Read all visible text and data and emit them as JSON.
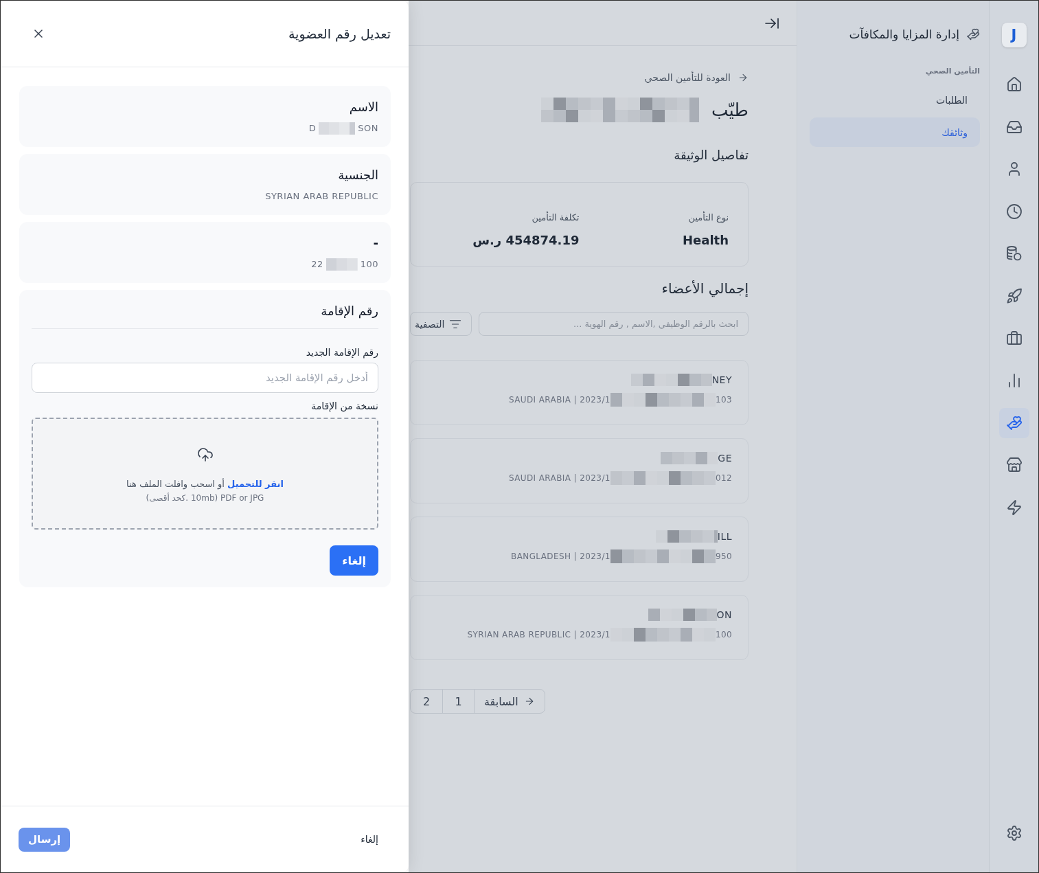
{
  "drawer": {
    "title": "تعديل رقم العضوية",
    "info_cards": [
      {
        "kind": "redacted",
        "label": "الاسم",
        "value_start": "D",
        "value_end": "SON"
      },
      {
        "kind": "plain",
        "label": "الجنسية",
        "value": "SYRIAN ARAB REPUBLIC"
      },
      {
        "kind": "redacted",
        "label": "-",
        "value_start": "22",
        "value_end": "100"
      }
    ],
    "residence": {
      "title": "رقم الإقامة",
      "field_label": "رقم الإقامة الجديد",
      "placeholder": "أدخل رقم الإقامة الجديد",
      "upload_label": "نسخة من الإقامة",
      "upload_link": "انقر للتحميل",
      "upload_text": "أو اسحب وافلت الملف هنا",
      "file_types": "PDF or JPG",
      "size_limit": "(10mb .كحد أقصى)",
      "button": "إلغاء"
    },
    "footer": {
      "cancel": "إلغاء",
      "submit": {
        "label": "إرسال",
        "disabled": true
      }
    }
  },
  "page": {
    "back_link": "العودة للتأمين الصحي",
    "title": "طيّب",
    "policy": {
      "heading": "تفاصيل الوثيقة",
      "fields": [
        {
          "label": "نوع التأمين",
          "value": "Health"
        },
        {
          "label": "تكلفة التأمين",
          "value": "454874.19 ر.س"
        }
      ]
    },
    "members": {
      "heading": "إجمالي الأعضاء",
      "search_placeholder": "ابحث بالرقم الوظيفي ,الاسم , رقم الهوية ...",
      "filter": "التصفية",
      "rows": [
        {
          "name_end": "NEY",
          "meta_start": "SAUDI ARABIA | 2023/1",
          "meta_end": "103"
        },
        {
          "name_end": "GE",
          "meta_start": "SAUDI ARABIA | 2023/1",
          "meta_end": "012"
        },
        {
          "name_end": "ILL",
          "meta_start": "BANGLADESH | 2023/1",
          "meta_end": "950"
        },
        {
          "name_end": "ON",
          "meta_start": "SYRIAN ARAB REPUBLIC | 2023/1",
          "meta_end": "100"
        }
      ]
    },
    "pagination": {
      "previous": "السابقة",
      "pages": [
        "1",
        "2"
      ]
    }
  },
  "sidebar": {
    "title": "إدارة المزايا والمكافآت",
    "section": "التأمين الصحي",
    "items": [
      {
        "label": "الطلبات",
        "selected": false
      },
      {
        "label": "وثائقك",
        "selected": true
      }
    ]
  },
  "rail": {
    "logo": "J",
    "items": [
      {
        "selected": false
      },
      {
        "selected": false
      },
      {
        "selected": false
      },
      {
        "selected": false
      },
      {
        "selected": false
      },
      {
        "selected": false
      },
      {
        "selected": false
      },
      {
        "selected": false
      },
      {
        "selected": true
      },
      {
        "selected": false
      },
      {
        "selected": false
      }
    ]
  }
}
